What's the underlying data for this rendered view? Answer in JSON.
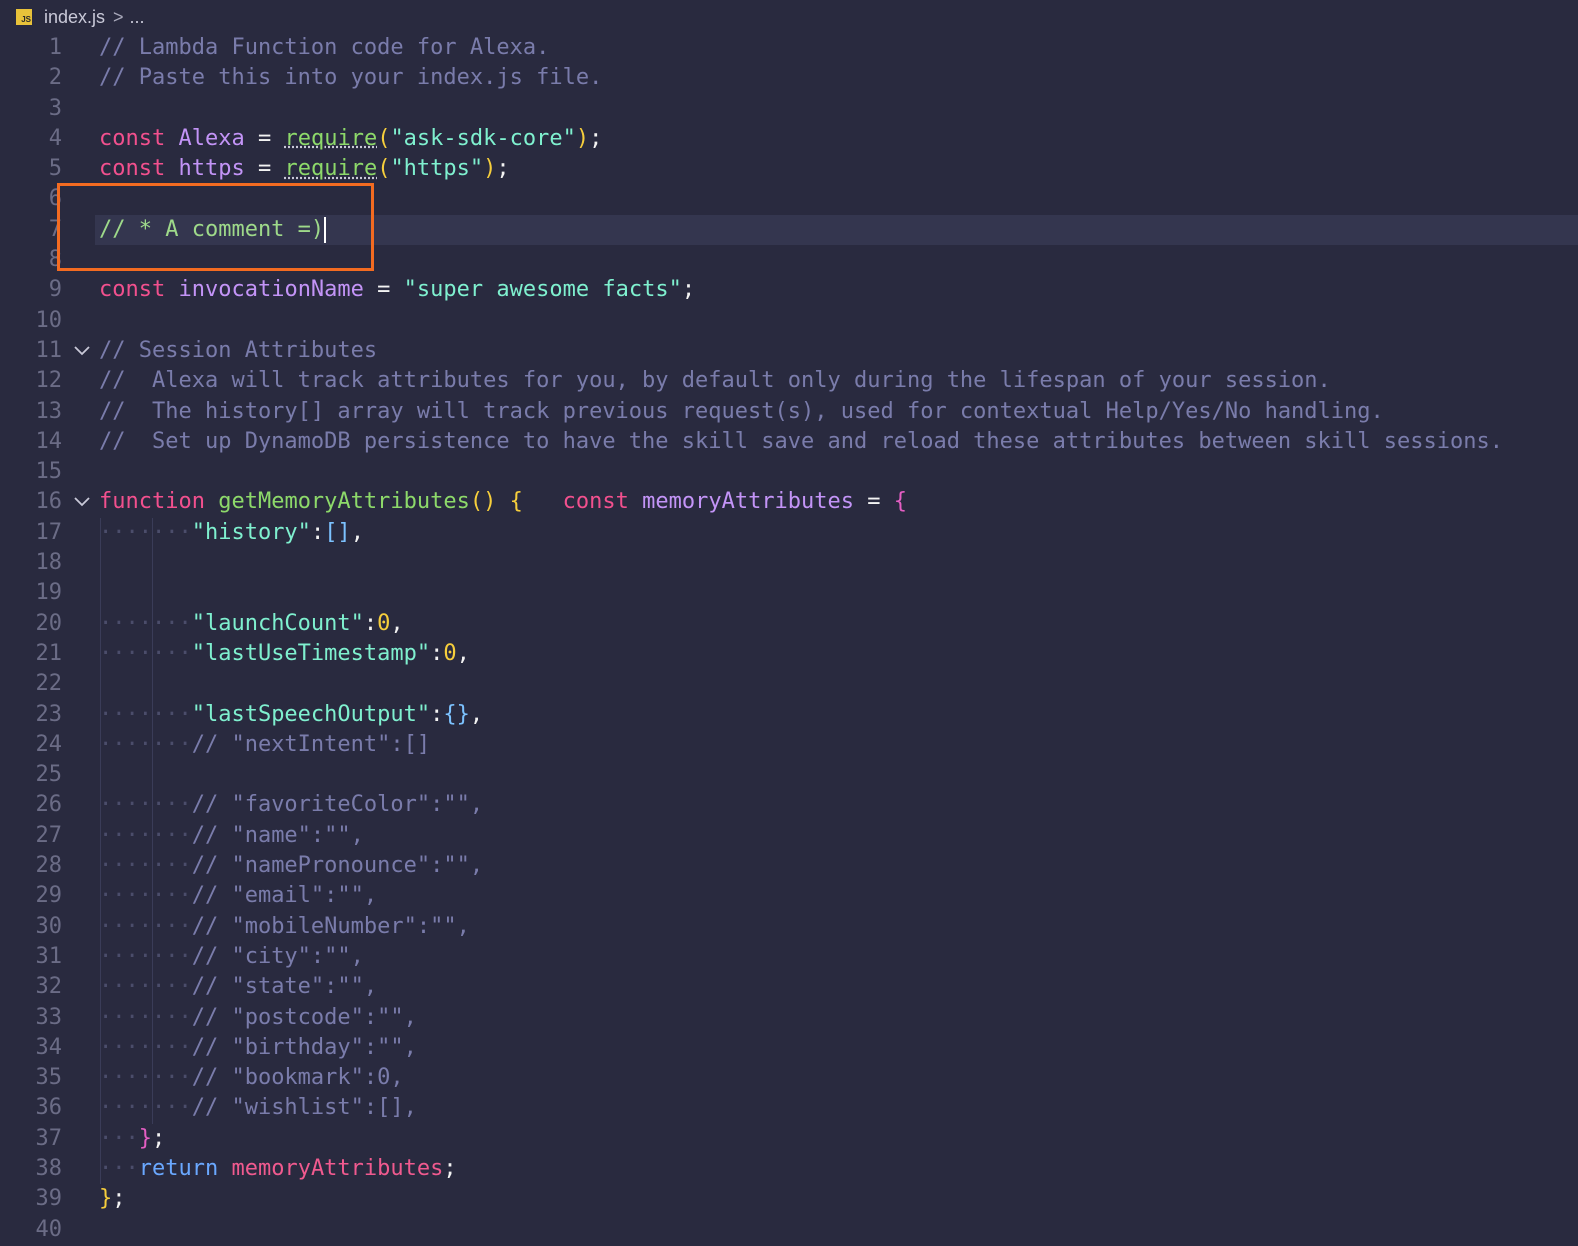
{
  "breadcrumb": {
    "file_badge": "JS",
    "file_name": "index.js",
    "separator": ">",
    "ellipsis": "..."
  },
  "lines": [
    {
      "n": "1",
      "tokens": [
        [
          "cm",
          "// Lambda Function code for Alexa."
        ]
      ]
    },
    {
      "n": "2",
      "tokens": [
        [
          "cm",
          "// Paste this into your index.js file."
        ]
      ]
    },
    {
      "n": "3",
      "tokens": []
    },
    {
      "n": "4",
      "tokens": [
        [
          "kw",
          "const "
        ],
        [
          "var",
          "Alexa"
        ],
        [
          "punc",
          " = "
        ],
        [
          "fn",
          "require"
        ],
        [
          "brace",
          "("
        ],
        [
          "str",
          "\"ask-sdk-core\""
        ],
        [
          "brace",
          ")"
        ],
        [
          "punc",
          ";"
        ]
      ]
    },
    {
      "n": "5",
      "tokens": [
        [
          "kw",
          "const "
        ],
        [
          "var",
          "https"
        ],
        [
          "punc",
          " = "
        ],
        [
          "fn",
          "require"
        ],
        [
          "brace",
          "("
        ],
        [
          "str",
          "\"https\""
        ],
        [
          "brace",
          ")"
        ],
        [
          "punc",
          ";"
        ]
      ]
    },
    {
      "n": "6",
      "tokens": []
    },
    {
      "n": "7",
      "tokens": [
        [
          "cm-green",
          "// * A comment =)"
        ]
      ],
      "current": true
    },
    {
      "n": "8",
      "tokens": []
    },
    {
      "n": "9",
      "tokens": [
        [
          "kw",
          "const "
        ],
        [
          "var",
          "invocationName"
        ],
        [
          "punc",
          " = "
        ],
        [
          "str",
          "\"super awesome facts\""
        ],
        [
          "punc",
          ";"
        ]
      ]
    },
    {
      "n": "10",
      "tokens": []
    },
    {
      "n": "11",
      "tokens": [
        [
          "cm",
          "// Session Attributes"
        ]
      ],
      "fold": true
    },
    {
      "n": "12",
      "tokens": [
        [
          "cm",
          "//  Alexa will track attributes for you, by default only during the lifespan of your session."
        ]
      ]
    },
    {
      "n": "13",
      "tokens": [
        [
          "cm",
          "//  The history[] array will track previous request(s), used for contextual Help/Yes/No handling."
        ]
      ]
    },
    {
      "n": "14",
      "tokens": [
        [
          "cm",
          "//  Set up DynamoDB persistence to have the skill save and reload these attributes between skill sessions."
        ]
      ]
    },
    {
      "n": "15",
      "tokens": []
    },
    {
      "n": "16",
      "tokens": [
        [
          "kw",
          "function "
        ],
        [
          "fn",
          "getMemoryAttributes"
        ],
        [
          "brace",
          "() {"
        ],
        [
          "punc",
          "   "
        ],
        [
          "kw",
          "const "
        ],
        [
          "var",
          "memoryAttributes"
        ],
        [
          "punc",
          " = "
        ],
        [
          "brace2",
          "{"
        ]
      ],
      "fold": true
    },
    {
      "n": "17",
      "tokens": [
        [
          "ws",
          "·······"
        ],
        [
          "str",
          "\"history\""
        ],
        [
          "punc",
          ":"
        ],
        [
          "brace3",
          "[]"
        ],
        [
          "punc",
          ","
        ]
      ]
    },
    {
      "n": "18",
      "tokens": []
    },
    {
      "n": "19",
      "tokens": []
    },
    {
      "n": "20",
      "tokens": [
        [
          "ws",
          "·······"
        ],
        [
          "str",
          "\"launchCount\""
        ],
        [
          "punc",
          ":"
        ],
        [
          "num",
          "0"
        ],
        [
          "punc",
          ","
        ]
      ]
    },
    {
      "n": "21",
      "tokens": [
        [
          "ws",
          "·······"
        ],
        [
          "str",
          "\"lastUseTimestamp\""
        ],
        [
          "punc",
          ":"
        ],
        [
          "num",
          "0"
        ],
        [
          "punc",
          ","
        ]
      ]
    },
    {
      "n": "22",
      "tokens": []
    },
    {
      "n": "23",
      "tokens": [
        [
          "ws",
          "·······"
        ],
        [
          "str",
          "\"lastSpeechOutput\""
        ],
        [
          "punc",
          ":"
        ],
        [
          "brace3",
          "{}"
        ],
        [
          "punc",
          ","
        ]
      ]
    },
    {
      "n": "24",
      "tokens": [
        [
          "ws",
          "·······"
        ],
        [
          "cm",
          "// \"nextIntent\":[]"
        ]
      ]
    },
    {
      "n": "25",
      "tokens": []
    },
    {
      "n": "26",
      "tokens": [
        [
          "ws",
          "·······"
        ],
        [
          "cm",
          "// \"favoriteColor\":\"\","
        ]
      ]
    },
    {
      "n": "27",
      "tokens": [
        [
          "ws",
          "·······"
        ],
        [
          "cm",
          "// \"name\":\"\","
        ]
      ]
    },
    {
      "n": "28",
      "tokens": [
        [
          "ws",
          "·······"
        ],
        [
          "cm",
          "// \"namePronounce\":\"\","
        ]
      ]
    },
    {
      "n": "29",
      "tokens": [
        [
          "ws",
          "·······"
        ],
        [
          "cm",
          "// \"email\":\"\","
        ]
      ]
    },
    {
      "n": "30",
      "tokens": [
        [
          "ws",
          "·······"
        ],
        [
          "cm",
          "// \"mobileNumber\":\"\","
        ]
      ]
    },
    {
      "n": "31",
      "tokens": [
        [
          "ws",
          "·······"
        ],
        [
          "cm",
          "// \"city\":\"\","
        ]
      ]
    },
    {
      "n": "32",
      "tokens": [
        [
          "ws",
          "·······"
        ],
        [
          "cm",
          "// \"state\":\"\","
        ]
      ]
    },
    {
      "n": "33",
      "tokens": [
        [
          "ws",
          "·······"
        ],
        [
          "cm",
          "// \"postcode\":\"\","
        ]
      ]
    },
    {
      "n": "34",
      "tokens": [
        [
          "ws",
          "·······"
        ],
        [
          "cm",
          "// \"birthday\":\"\","
        ]
      ]
    },
    {
      "n": "35",
      "tokens": [
        [
          "ws",
          "·······"
        ],
        [
          "cm",
          "// \"bookmark\":0,"
        ]
      ]
    },
    {
      "n": "36",
      "tokens": [
        [
          "ws",
          "·······"
        ],
        [
          "cm",
          "// \"wishlist\":[],"
        ]
      ]
    },
    {
      "n": "37",
      "tokens": [
        [
          "ws",
          "···"
        ],
        [
          "brace2",
          "}"
        ],
        [
          "punc",
          ";"
        ]
      ]
    },
    {
      "n": "38",
      "tokens": [
        [
          "ws",
          "···"
        ],
        [
          "ret",
          "return "
        ],
        [
          "pink-var",
          "memoryAttributes"
        ],
        [
          "punc",
          ";"
        ]
      ]
    },
    {
      "n": "39",
      "tokens": [
        [
          "brace",
          "}"
        ],
        [
          "punc",
          ";"
        ]
      ]
    },
    {
      "n": "40",
      "tokens": []
    }
  ],
  "colors": {
    "background": "#292a3f",
    "highlight_box": "#f36b21",
    "keyword": "#f2508e",
    "function": "#8dd96a",
    "variable": "#c394f7",
    "string": "#7ff0cf",
    "comment": "#7a7cab"
  }
}
